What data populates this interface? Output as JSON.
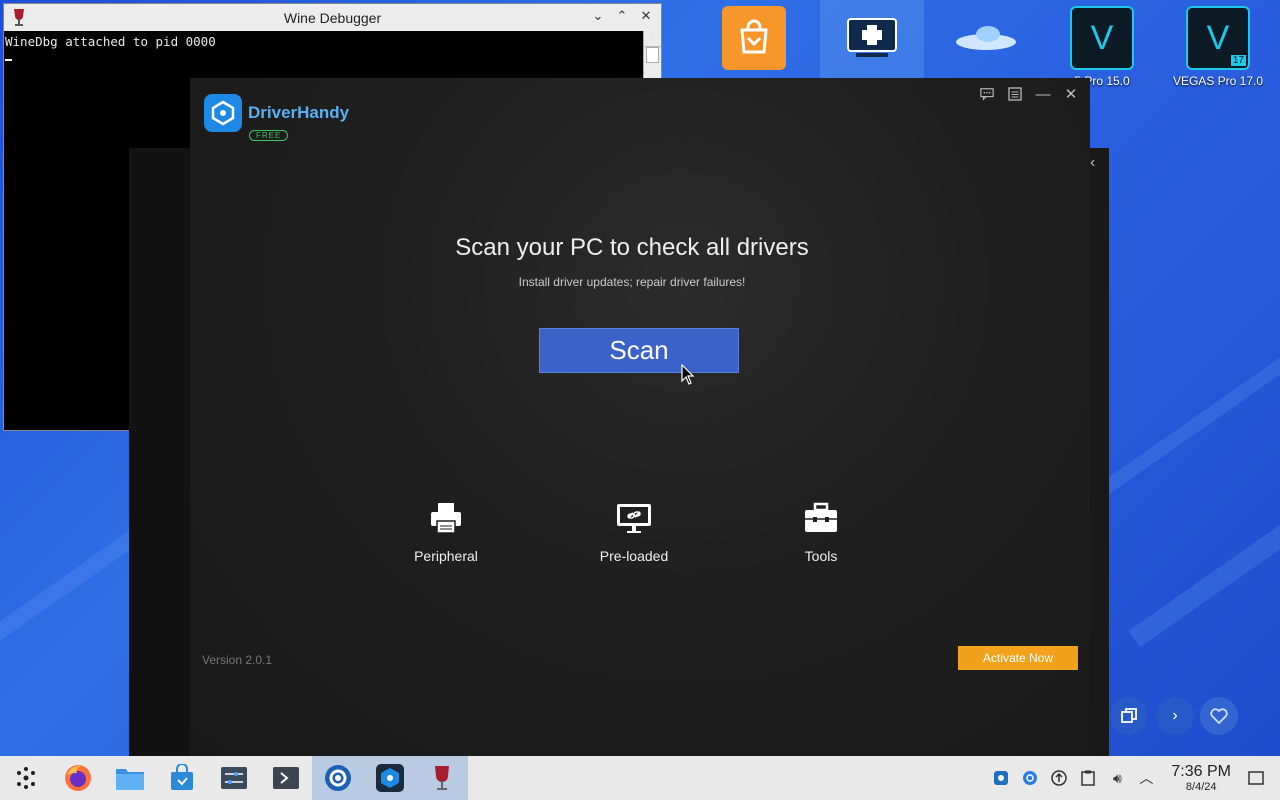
{
  "desktop": {
    "icons": [
      {
        "label": "",
        "icon": "shopping-bag-icon"
      },
      {
        "label": "",
        "icon": "monitor-plus-icon"
      },
      {
        "label": "",
        "icon": "ufo-icon"
      },
      {
        "label": "5 Pro 15.0",
        "icon": "vegas-icon"
      },
      {
        "label": "VEGAS Pro 17.0",
        "icon": "vegas-17-icon"
      }
    ]
  },
  "wine_debugger": {
    "title": "Wine Debugger",
    "output": "WineDbg attached to pid 0000"
  },
  "driver_handy": {
    "brand": "DriverHandy",
    "badge": "FREE",
    "headline": "Scan your PC to check all drivers",
    "subheadline": "Install driver updates; repair driver failures!",
    "scan_label": "Scan",
    "features": [
      {
        "label": "Peripheral",
        "icon": "printer-icon"
      },
      {
        "label": "Pre-loaded",
        "icon": "monitor-link-icon"
      },
      {
        "label": "Tools",
        "icon": "toolbox-icon"
      }
    ],
    "version": "Version 2.0.1",
    "activate_label": "Activate Now"
  },
  "taskbar": {
    "items": [
      "app-launcher",
      "firefox",
      "file-manager",
      "discover-store",
      "system-settings",
      "konsole",
      "settings-gear",
      "driver-handy",
      "wine"
    ],
    "time": "7:36 PM",
    "date": "8/4/24"
  }
}
